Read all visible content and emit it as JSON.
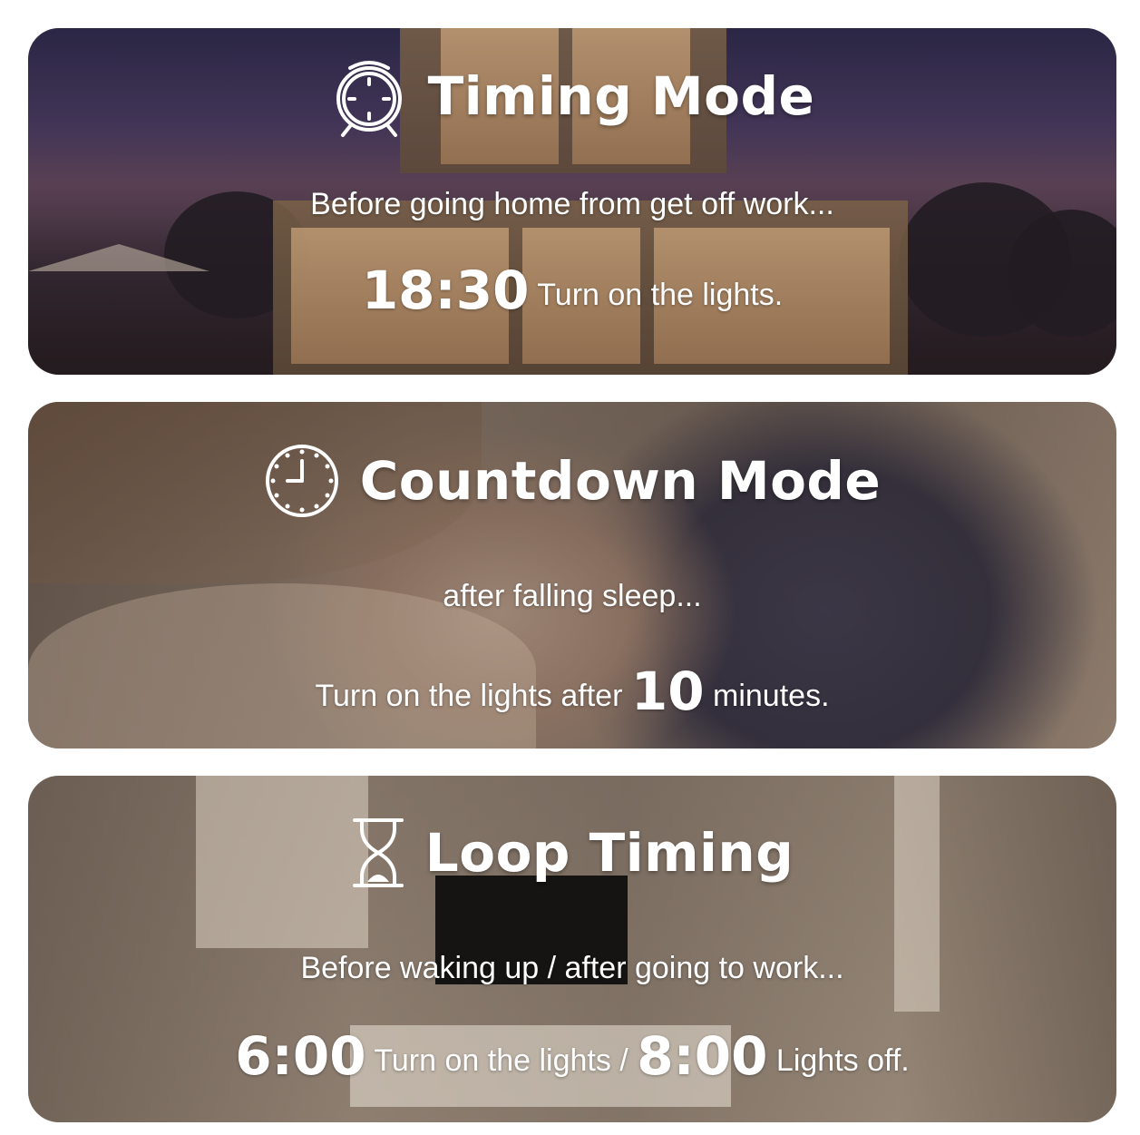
{
  "cards": [
    {
      "icon": "alarm-clock-icon",
      "title": "Timing Mode",
      "subtitle": "Before going home from get off work...",
      "action": {
        "time": "18:30",
        "text": "Turn on the lights."
      }
    },
    {
      "icon": "clock-icon",
      "title": "Countdown Mode",
      "subtitle": "after falling sleep...",
      "action": {
        "prefix": "Turn on the lights after",
        "number": "10",
        "suffix": "minutes."
      }
    },
    {
      "icon": "hourglass-icon",
      "title": "Loop Timing",
      "subtitle": "Before waking up / after going to work...",
      "action": {
        "time_on": "6:00",
        "text_on": "Turn on the lights /",
        "time_off": "8:00",
        "text_off": "Lights off."
      }
    }
  ]
}
